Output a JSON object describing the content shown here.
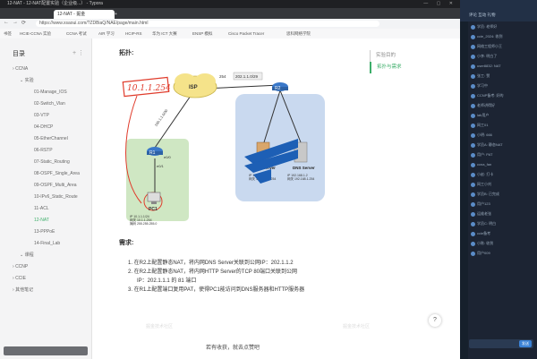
{
  "browser": {
    "title": "12-NAT - 12-NAT配置实验（企业级...） - Typora",
    "tab_active": "12-NAT - 掘金",
    "url": "https://www.xsaoui.com/?ZDBiaQ/NAE/page/main.html",
    "bookmarks": [
      "书签",
      "HCIE-CCNA 实验",
      "CCNA 考试",
      "AIR 学习",
      "HCIP-RS",
      "华为 ICT 大赛",
      "ENSP 模拟",
      "Cisco Packet Tracer",
      "思科网络学院"
    ]
  },
  "sidebar": {
    "heading": "目录",
    "items": [
      {
        "label": "CCNA",
        "level": 0
      },
      {
        "label": "实验",
        "level": 1
      },
      {
        "label": "01-Manage_IOS",
        "level": 2
      },
      {
        "label": "02-Switch_Vlan",
        "level": 2
      },
      {
        "label": "03-VTP",
        "level": 2
      },
      {
        "label": "04-DHCP",
        "level": 2
      },
      {
        "label": "05-EtherChannel",
        "level": 2
      },
      {
        "label": "06-RSTP",
        "level": 2
      },
      {
        "label": "07-Static_Routing",
        "level": 2
      },
      {
        "label": "08-OSPF_Single_Area",
        "level": 2
      },
      {
        "label": "09-OSPF_Multi_Area",
        "level": 2
      },
      {
        "label": "10-IPv6_Static_Route",
        "level": 2
      },
      {
        "label": "11-ACL",
        "level": 2
      },
      {
        "label": "12-NAT",
        "level": 2,
        "active": true
      },
      {
        "label": "13-PPPoE",
        "level": 2
      },
      {
        "label": "14-Final_Lab",
        "level": 2
      },
      {
        "label": "课程",
        "level": 1
      },
      {
        "label": "CCNP",
        "level": 0
      },
      {
        "label": "CCIE",
        "level": 0
      },
      {
        "label": "其他笔记",
        "level": 0
      }
    ]
  },
  "content": {
    "topo_heading": "拓扑:",
    "req_heading": "需求:",
    "requirements": [
      "1. 在R2上配置静态NAT，将内网DNS Server关联到公网IP：202.1.1.2",
      "2. 在R2上配置静态NAT，将内网HTTP Server的TCP 80端口关联到公网",
      "IP：202.1.1.1 的 81 端口",
      "3. 在R1上配置端口复用PAT，使得PC1能访问到DNS服务器和HTTP服务器"
    ],
    "caption": "若有收获，就去点赞吧",
    "watermark": "掘金技术社区",
    "right_toc": [
      "实验目的",
      "拓扑与需求"
    ]
  },
  "diagram": {
    "isp": "ISP",
    "r1": "R1",
    "r2": "R2",
    "pc1": "PC1",
    "http": "HTTP Server",
    "dns": "DNS Server",
    "net_public": "202.1.1.0/29",
    "net_isp_r1": "100.1.1.0/30",
    "handwritten": "10.1.1.254",
    "iface_e00": "e0/0",
    "iface_e01": "e0/1",
    "iface_254": "254",
    "pc_info": [
      "IP 10.1.1.1/24",
      "网关 10.1.1.254",
      "掩码 255.255.255.0"
    ],
    "http_info": [
      "IP 192.168.1.1",
      "网关 192.168.1.254"
    ],
    "dns_info": [
      "IP 192.168.1.2",
      "网关 192.168.1.254"
    ]
  },
  "chat": {
    "header": "评论 互动 礼物",
    "messages": [
      "学员: 老师好",
      "ccie_2024: 收到",
      "网络工程师小王",
      "小李: 明白了",
      "user8832: NAT",
      "张工: 赞",
      "学习中",
      "CCNP备考: 好的",
      "老师讲得好",
      "lab用户",
      "网工01",
      "小明: 666",
      "学员A: 静态NAT",
      "用户: PAT",
      "ccna_fan",
      "小赵: 打卡",
      "网工小刘",
      "学员B: 已完成",
      "用户123",
      "运维老张",
      "学员C: 明白",
      "ccie备考",
      "小陈: 收到",
      "用户009"
    ],
    "send": "发送"
  }
}
